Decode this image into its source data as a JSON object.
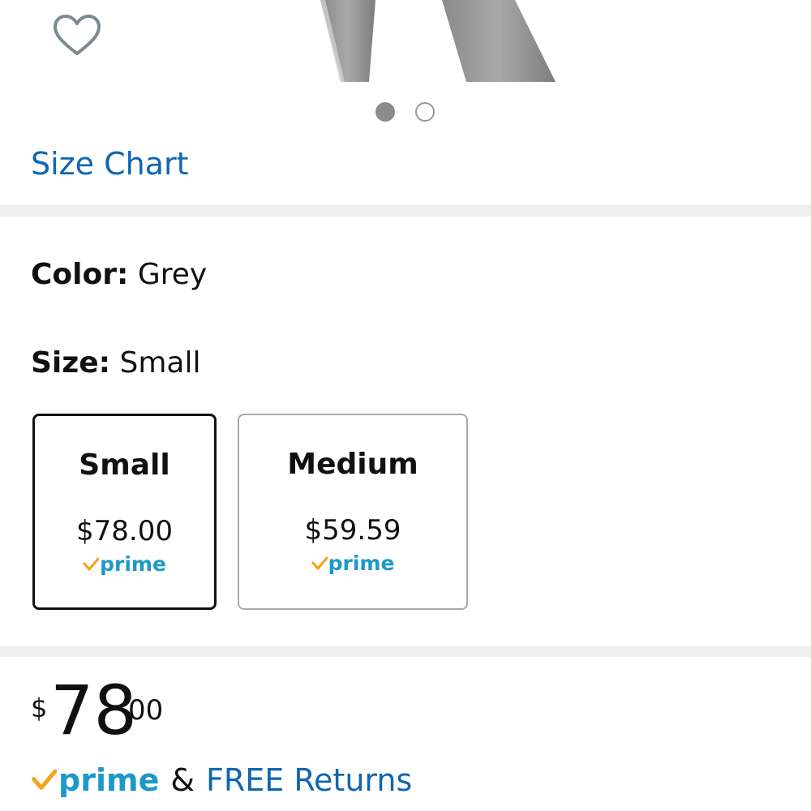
{
  "gallery": {
    "image_alt": "Grey jeans product photo",
    "wishlist_icon": "heart-outline-icon",
    "dot_count": 2,
    "active_dot": 0
  },
  "size_chart": {
    "label": "Size Chart"
  },
  "variations": {
    "color": {
      "key": "Color:",
      "value": "Grey"
    },
    "size": {
      "key": "Size:",
      "value": "Small"
    },
    "size_options": [
      {
        "name": "Small",
        "price": "$78.00",
        "prime": "prime",
        "selected": true
      },
      {
        "name": "Medium",
        "price": "$59.59",
        "prime": "prime",
        "selected": false
      }
    ]
  },
  "price": {
    "symbol": "$",
    "whole": "78",
    "fraction": "00"
  },
  "shipping": {
    "prime": "prime",
    "amp": "&",
    "returns_label": "FREE Returns"
  },
  "colors": {
    "link": "#0f66b0",
    "prime_blue": "#1d99c8",
    "prime_orange": "#f7a21b",
    "divider": "#eeeeee"
  }
}
